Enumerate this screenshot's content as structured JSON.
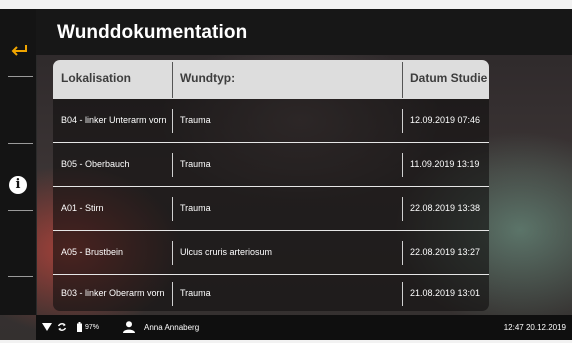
{
  "header": {
    "title": "Wunddokumentation"
  },
  "sidebar": {
    "back_icon": "back-arrow-icon",
    "info_icon": "info-icon",
    "info_glyph": "i"
  },
  "table": {
    "columns": [
      "Lokalisation",
      "Wundtyp:",
      "Datum Studie"
    ],
    "rows": [
      {
        "lokalisation": "B04 - linker Unterarm vorn",
        "wundtyp": "Trauma",
        "datum": "12.09.2019 07:46"
      },
      {
        "lokalisation": "B05 - Oberbauch",
        "wundtyp": "Trauma",
        "datum": "11.09.2019 13:19"
      },
      {
        "lokalisation": "A01 - Stirn",
        "wundtyp": "Trauma",
        "datum": "22.08.2019 13:38"
      },
      {
        "lokalisation": "A05 - Brustbein",
        "wundtyp": "Ulcus cruris arteriosum",
        "datum": "22.08.2019 13:27"
      },
      {
        "lokalisation": "B03 - linker Oberarm vorn",
        "wundtyp": "Trauma",
        "datum": "21.08.2019 13:01"
      }
    ]
  },
  "statusbar": {
    "battery": "97%",
    "user": "Anna Annaberg",
    "datetime": "12:47 20.12.2019",
    "icons": [
      "wifi-icon",
      "sync-icon",
      "battery-icon",
      "user-icon"
    ]
  },
  "colors": {
    "accent": "#f0a500",
    "header_bg": "#171717",
    "table_header_bg": "#dddddd"
  }
}
